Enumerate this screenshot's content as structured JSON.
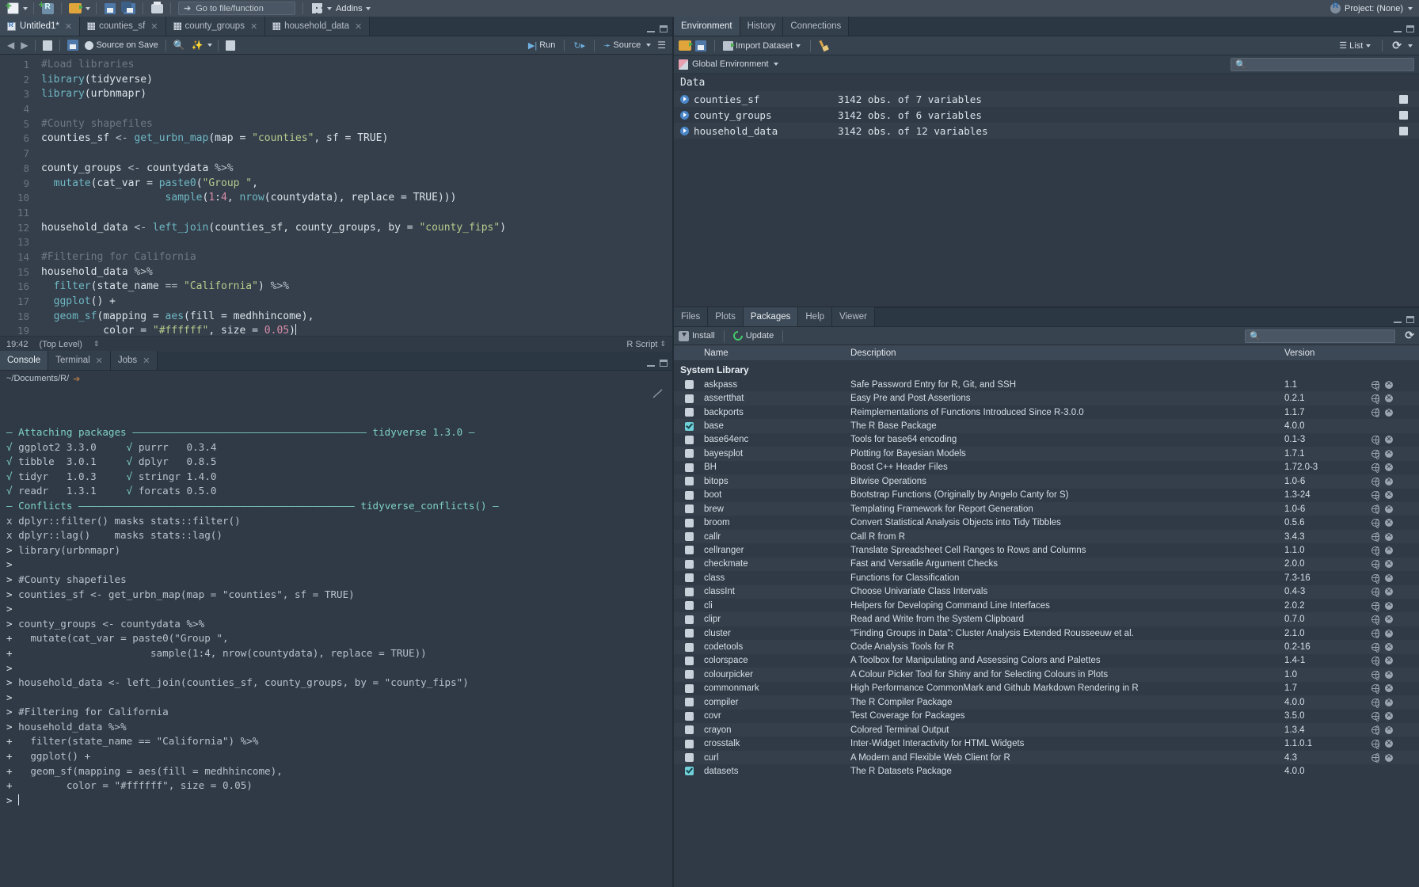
{
  "toolbar": {
    "goto_placeholder": "Go to file/function",
    "addins_label": "Addins",
    "project_label": "Project: (None)",
    "icons": [
      "new-file-icon",
      "new-project-icon",
      "open-folder-icon",
      "save-icon",
      "save-all-icon",
      "print-icon",
      "goto-arrow-icon",
      "panes-grid-icon",
      "r-logo-icon"
    ]
  },
  "source": {
    "tabs": [
      {
        "label": "Untitled1*",
        "icon": "r-document-icon",
        "closable": true,
        "active": true
      },
      {
        "label": "counties_sf",
        "icon": "data-grid-icon",
        "closable": true,
        "active": false
      },
      {
        "label": "county_groups",
        "icon": "data-grid-icon",
        "closable": true,
        "active": false
      },
      {
        "label": "household_data",
        "icon": "data-grid-icon",
        "closable": true,
        "active": false
      }
    ],
    "toolbar": {
      "source_on_save": "Source on Save",
      "run": "Run",
      "source": "Source"
    },
    "status": {
      "position": "19:42",
      "scope": "(Top Level)",
      "file_type": "R Script"
    },
    "code_lines": [
      {
        "n": 1,
        "tokens": [
          {
            "t": "#Load libraries",
            "c": "cmt"
          }
        ]
      },
      {
        "n": 2,
        "tokens": [
          {
            "t": "library",
            "c": "fn"
          },
          {
            "t": "(tidyverse)",
            "c": "txt"
          }
        ]
      },
      {
        "n": 3,
        "tokens": [
          {
            "t": "library",
            "c": "fn"
          },
          {
            "t": "(urbnmapr)",
            "c": "txt"
          }
        ]
      },
      {
        "n": 4,
        "tokens": []
      },
      {
        "n": 5,
        "tokens": [
          {
            "t": "#County shapefiles",
            "c": "cmt"
          }
        ]
      },
      {
        "n": 6,
        "tokens": [
          {
            "t": "counties_sf ",
            "c": "txt"
          },
          {
            "t": "<- ",
            "c": "op"
          },
          {
            "t": "get_urbn_map",
            "c": "fn"
          },
          {
            "t": "(map = ",
            "c": "txt"
          },
          {
            "t": "\"counties\"",
            "c": "str"
          },
          {
            "t": ", sf = TRUE)",
            "c": "txt"
          }
        ]
      },
      {
        "n": 7,
        "tokens": []
      },
      {
        "n": 8,
        "tokens": [
          {
            "t": "county_groups ",
            "c": "txt"
          },
          {
            "t": "<- ",
            "c": "op"
          },
          {
            "t": "countydata ",
            "c": "txt"
          },
          {
            "t": "%>%",
            "c": "op"
          }
        ]
      },
      {
        "n": 9,
        "tokens": [
          {
            "t": "  ",
            "c": "txt"
          },
          {
            "t": "mutate",
            "c": "fn"
          },
          {
            "t": "(cat_var = ",
            "c": "txt"
          },
          {
            "t": "paste0",
            "c": "fn"
          },
          {
            "t": "(",
            "c": "txt"
          },
          {
            "t": "\"Group \"",
            "c": "str"
          },
          {
            "t": ",",
            "c": "txt"
          }
        ]
      },
      {
        "n": 10,
        "tokens": [
          {
            "t": "                    ",
            "c": "txt"
          },
          {
            "t": "sample",
            "c": "fn"
          },
          {
            "t": "(",
            "c": "txt"
          },
          {
            "t": "1",
            "c": "num"
          },
          {
            "t": ":",
            "c": "txt"
          },
          {
            "t": "4",
            "c": "num"
          },
          {
            "t": ", ",
            "c": "txt"
          },
          {
            "t": "nrow",
            "c": "fn"
          },
          {
            "t": "(countydata), replace = TRUE)))",
            "c": "txt"
          }
        ]
      },
      {
        "n": 11,
        "tokens": []
      },
      {
        "n": 12,
        "tokens": [
          {
            "t": "household_data ",
            "c": "txt"
          },
          {
            "t": "<- ",
            "c": "op"
          },
          {
            "t": "left_join",
            "c": "fn"
          },
          {
            "t": "(counties_sf, county_groups, by = ",
            "c": "txt"
          },
          {
            "t": "\"county_fips\"",
            "c": "str"
          },
          {
            "t": ")",
            "c": "txt"
          }
        ]
      },
      {
        "n": 13,
        "tokens": []
      },
      {
        "n": 14,
        "tokens": [
          {
            "t": "#Filtering for California",
            "c": "cmt"
          }
        ]
      },
      {
        "n": 15,
        "tokens": [
          {
            "t": "household_data ",
            "c": "txt"
          },
          {
            "t": "%>%",
            "c": "op"
          }
        ]
      },
      {
        "n": 16,
        "tokens": [
          {
            "t": "  ",
            "c": "txt"
          },
          {
            "t": "filter",
            "c": "fn"
          },
          {
            "t": "(state_name ",
            "c": "txt"
          },
          {
            "t": "==",
            "c": "op"
          },
          {
            "t": " ",
            "c": "txt"
          },
          {
            "t": "\"California\"",
            "c": "str"
          },
          {
            "t": ") ",
            "c": "txt"
          },
          {
            "t": "%>%",
            "c": "op"
          }
        ]
      },
      {
        "n": 17,
        "tokens": [
          {
            "t": "  ",
            "c": "txt"
          },
          {
            "t": "ggplot",
            "c": "fn"
          },
          {
            "t": "() +",
            "c": "txt"
          }
        ]
      },
      {
        "n": 18,
        "tokens": [
          {
            "t": "  ",
            "c": "txt"
          },
          {
            "t": "geom_sf",
            "c": "fn"
          },
          {
            "t": "(mapping = ",
            "c": "txt"
          },
          {
            "t": "aes",
            "c": "fn"
          },
          {
            "t": "(fill = medhhincome),",
            "c": "txt"
          }
        ]
      },
      {
        "n": 19,
        "tokens": [
          {
            "t": "          color = ",
            "c": "txt"
          },
          {
            "t": "\"#ffffff\"",
            "c": "str"
          },
          {
            "t": ", size = ",
            "c": "txt"
          },
          {
            "t": "0.05",
            "c": "num"
          },
          {
            "t": ")",
            "c": "txt"
          },
          {
            "t": "|",
            "c": "cursor"
          }
        ]
      }
    ]
  },
  "console": {
    "tabs": [
      {
        "label": "Console",
        "closable": false,
        "active": true
      },
      {
        "label": "Terminal",
        "closable": true,
        "active": false
      },
      {
        "label": "Jobs",
        "closable": true,
        "active": false
      }
    ],
    "path": "~/Documents/R/",
    "lines": [
      [
        {
          "t": "— Attaching packages ",
          "c": "teal"
        },
        {
          "t": "———————————————————————————————————————",
          "c": "teal"
        },
        {
          "t": " tidyverse 1.3.0 —",
          "c": "teal"
        }
      ],
      [
        {
          "t": "√ ",
          "c": "ok"
        },
        {
          "t": "ggplot2 3.3.0     ",
          "c": "grey"
        },
        {
          "t": "√ ",
          "c": "ok"
        },
        {
          "t": "purrr   0.3.4",
          "c": "grey"
        }
      ],
      [
        {
          "t": "√ ",
          "c": "ok"
        },
        {
          "t": "tibble  3.0.1     ",
          "c": "grey"
        },
        {
          "t": "√ ",
          "c": "ok"
        },
        {
          "t": "dplyr   0.8.5",
          "c": "grey"
        }
      ],
      [
        {
          "t": "√ ",
          "c": "ok"
        },
        {
          "t": "tidyr   1.0.3     ",
          "c": "grey"
        },
        {
          "t": "√ ",
          "c": "ok"
        },
        {
          "t": "stringr 1.4.0",
          "c": "grey"
        }
      ],
      [
        {
          "t": "√ ",
          "c": "ok"
        },
        {
          "t": "readr   1.3.1     ",
          "c": "grey"
        },
        {
          "t": "√ ",
          "c": "ok"
        },
        {
          "t": "forcats 0.5.0",
          "c": "grey"
        }
      ],
      [
        {
          "t": "— Conflicts ",
          "c": "teal"
        },
        {
          "t": "——————————————————————————————————————————————",
          "c": "teal"
        },
        {
          "t": " tidyverse_conflicts() —",
          "c": "teal"
        }
      ],
      [
        {
          "t": "x dplyr::filter() masks stats::filter()",
          "c": "grey"
        }
      ],
      [
        {
          "t": "x dplyr::lag()    masks stats::lag()",
          "c": "grey"
        }
      ],
      [
        {
          "t": "> ",
          "c": "prompt"
        },
        {
          "t": "library(urbnmapr)",
          "c": "grey"
        }
      ],
      [
        {
          "t": "> ",
          "c": "prompt"
        }
      ],
      [
        {
          "t": "> ",
          "c": "prompt"
        },
        {
          "t": "#County shapefiles",
          "c": "grey"
        }
      ],
      [
        {
          "t": "> ",
          "c": "prompt"
        },
        {
          "t": "counties_sf <- get_urbn_map(map = \"counties\", sf = TRUE)",
          "c": "grey"
        }
      ],
      [
        {
          "t": "> ",
          "c": "prompt"
        }
      ],
      [
        {
          "t": "> ",
          "c": "prompt"
        },
        {
          "t": "county_groups <- countydata %>%",
          "c": "grey"
        }
      ],
      [
        {
          "t": "+ ",
          "c": "prompt"
        },
        {
          "t": "  mutate(cat_var = paste0(\"Group \",",
          "c": "grey"
        }
      ],
      [
        {
          "t": "+ ",
          "c": "prompt"
        },
        {
          "t": "                      sample(1:4, nrow(countydata), replace = TRUE))",
          "c": "grey"
        }
      ],
      [
        {
          "t": "> ",
          "c": "prompt"
        }
      ],
      [
        {
          "t": "> ",
          "c": "prompt"
        },
        {
          "t": "household_data <- left_join(counties_sf, county_groups, by = \"county_fips\")",
          "c": "grey"
        }
      ],
      [
        {
          "t": "> ",
          "c": "prompt"
        }
      ],
      [
        {
          "t": "> ",
          "c": "prompt"
        },
        {
          "t": "#Filtering for California",
          "c": "grey"
        }
      ],
      [
        {
          "t": "> ",
          "c": "prompt"
        },
        {
          "t": "household_data %>%",
          "c": "grey"
        }
      ],
      [
        {
          "t": "+ ",
          "c": "prompt"
        },
        {
          "t": "  filter(state_name == \"California\") %>%",
          "c": "grey"
        }
      ],
      [
        {
          "t": "+ ",
          "c": "prompt"
        },
        {
          "t": "  ggplot() +",
          "c": "grey"
        }
      ],
      [
        {
          "t": "+ ",
          "c": "prompt"
        },
        {
          "t": "  geom_sf(mapping = aes(fill = medhhincome),",
          "c": "grey"
        }
      ],
      [
        {
          "t": "+ ",
          "c": "prompt"
        },
        {
          "t": "        color = \"#ffffff\", size = 0.05)",
          "c": "grey"
        }
      ],
      [
        {
          "t": "> ",
          "c": "prompt"
        },
        {
          "t": "|",
          "c": "cursor"
        }
      ]
    ]
  },
  "environment": {
    "tabs": [
      {
        "label": "Environment",
        "active": true
      },
      {
        "label": "History",
        "active": false
      },
      {
        "label": "Connections",
        "active": false
      }
    ],
    "toolbar": {
      "import_dataset": "Import Dataset",
      "view_mode": "List",
      "icons": [
        "open-folder-icon",
        "save-icon",
        "import-dataset-icon",
        "broom-icon",
        "list-view-icon",
        "refresh-icon"
      ]
    },
    "scope": "Global Environment",
    "search_value": "",
    "section_label": "Data",
    "items": [
      {
        "name": "counties_sf",
        "detail": "3142 obs. of 7 variables"
      },
      {
        "name": "county_groups",
        "detail": "3142 obs. of 6 variables"
      },
      {
        "name": "household_data",
        "detail": "3142 obs. of 12 variables"
      }
    ]
  },
  "packages": {
    "tabs": [
      {
        "label": "Files",
        "active": false
      },
      {
        "label": "Plots",
        "active": false
      },
      {
        "label": "Packages",
        "active": true
      },
      {
        "label": "Help",
        "active": false
      },
      {
        "label": "Viewer",
        "active": false
      }
    ],
    "toolbar": {
      "install": "Install",
      "update": "Update",
      "search_value": ""
    },
    "columns": {
      "name": "Name",
      "description": "Description",
      "version": "Version"
    },
    "section_label": "System Library",
    "rows": [
      {
        "name": "askpass",
        "desc": "Safe Password Entry for R, Git, and SSH",
        "ver": "1.1",
        "checked": false,
        "actions": true
      },
      {
        "name": "assertthat",
        "desc": "Easy Pre and Post Assertions",
        "ver": "0.2.1",
        "checked": false,
        "actions": true
      },
      {
        "name": "backports",
        "desc": "Reimplementations of Functions Introduced Since R-3.0.0",
        "ver": "1.1.7",
        "checked": false,
        "actions": true
      },
      {
        "name": "base",
        "desc": "The R Base Package",
        "ver": "4.0.0",
        "checked": true,
        "actions": false
      },
      {
        "name": "base64enc",
        "desc": "Tools for base64 encoding",
        "ver": "0.1-3",
        "checked": false,
        "actions": true
      },
      {
        "name": "bayesplot",
        "desc": "Plotting for Bayesian Models",
        "ver": "1.7.1",
        "checked": false,
        "actions": true
      },
      {
        "name": "BH",
        "desc": "Boost C++ Header Files",
        "ver": "1.72.0-3",
        "checked": false,
        "actions": true
      },
      {
        "name": "bitops",
        "desc": "Bitwise Operations",
        "ver": "1.0-6",
        "checked": false,
        "actions": true
      },
      {
        "name": "boot",
        "desc": "Bootstrap Functions (Originally by Angelo Canty for S)",
        "ver": "1.3-24",
        "checked": false,
        "actions": true
      },
      {
        "name": "brew",
        "desc": "Templating Framework for Report Generation",
        "ver": "1.0-6",
        "checked": false,
        "actions": true
      },
      {
        "name": "broom",
        "desc": "Convert Statistical Analysis Objects into Tidy Tibbles",
        "ver": "0.5.6",
        "checked": false,
        "actions": true
      },
      {
        "name": "callr",
        "desc": "Call R from R",
        "ver": "3.4.3",
        "checked": false,
        "actions": true
      },
      {
        "name": "cellranger",
        "desc": "Translate Spreadsheet Cell Ranges to Rows and Columns",
        "ver": "1.1.0",
        "checked": false,
        "actions": true
      },
      {
        "name": "checkmate",
        "desc": "Fast and Versatile Argument Checks",
        "ver": "2.0.0",
        "checked": false,
        "actions": true
      },
      {
        "name": "class",
        "desc": "Functions for Classification",
        "ver": "7.3-16",
        "checked": false,
        "actions": true
      },
      {
        "name": "classInt",
        "desc": "Choose Univariate Class Intervals",
        "ver": "0.4-3",
        "checked": false,
        "actions": true
      },
      {
        "name": "cli",
        "desc": "Helpers for Developing Command Line Interfaces",
        "ver": "2.0.2",
        "checked": false,
        "actions": true
      },
      {
        "name": "clipr",
        "desc": "Read and Write from the System Clipboard",
        "ver": "0.7.0",
        "checked": false,
        "actions": true
      },
      {
        "name": "cluster",
        "desc": "\"Finding Groups in Data\": Cluster Analysis Extended Rousseeuw et al.",
        "ver": "2.1.0",
        "checked": false,
        "actions": true
      },
      {
        "name": "codetools",
        "desc": "Code Analysis Tools for R",
        "ver": "0.2-16",
        "checked": false,
        "actions": true
      },
      {
        "name": "colorspace",
        "desc": "A Toolbox for Manipulating and Assessing Colors and Palettes",
        "ver": "1.4-1",
        "checked": false,
        "actions": true
      },
      {
        "name": "colourpicker",
        "desc": "A Colour Picker Tool for Shiny and for Selecting Colours in Plots",
        "ver": "1.0",
        "checked": false,
        "actions": true
      },
      {
        "name": "commonmark",
        "desc": "High Performance CommonMark and Github Markdown Rendering in R",
        "ver": "1.7",
        "checked": false,
        "actions": true
      },
      {
        "name": "compiler",
        "desc": "The R Compiler Package",
        "ver": "4.0.0",
        "checked": false,
        "actions": true
      },
      {
        "name": "covr",
        "desc": "Test Coverage for Packages",
        "ver": "3.5.0",
        "checked": false,
        "actions": true
      },
      {
        "name": "crayon",
        "desc": "Colored Terminal Output",
        "ver": "1.3.4",
        "checked": false,
        "actions": true
      },
      {
        "name": "crosstalk",
        "desc": "Inter-Widget Interactivity for HTML Widgets",
        "ver": "1.1.0.1",
        "checked": false,
        "actions": true
      },
      {
        "name": "curl",
        "desc": "A Modern and Flexible Web Client for R",
        "ver": "4.3",
        "checked": false,
        "actions": true
      },
      {
        "name": "datasets",
        "desc": "The R Datasets Package",
        "ver": "4.0.0",
        "checked": true,
        "actions": false
      }
    ]
  },
  "colors": {
    "bg": "#2b3743",
    "panel": "#2f3a46",
    "editor": "#343f4b",
    "toolbar": "#404b57",
    "accent_teal": "#7fd1c4",
    "accent_blue": "#4a86c8",
    "string_green": "#b5cc8e",
    "fn_cyan": "#6fb8c4",
    "num_pink": "#d88ca8"
  }
}
